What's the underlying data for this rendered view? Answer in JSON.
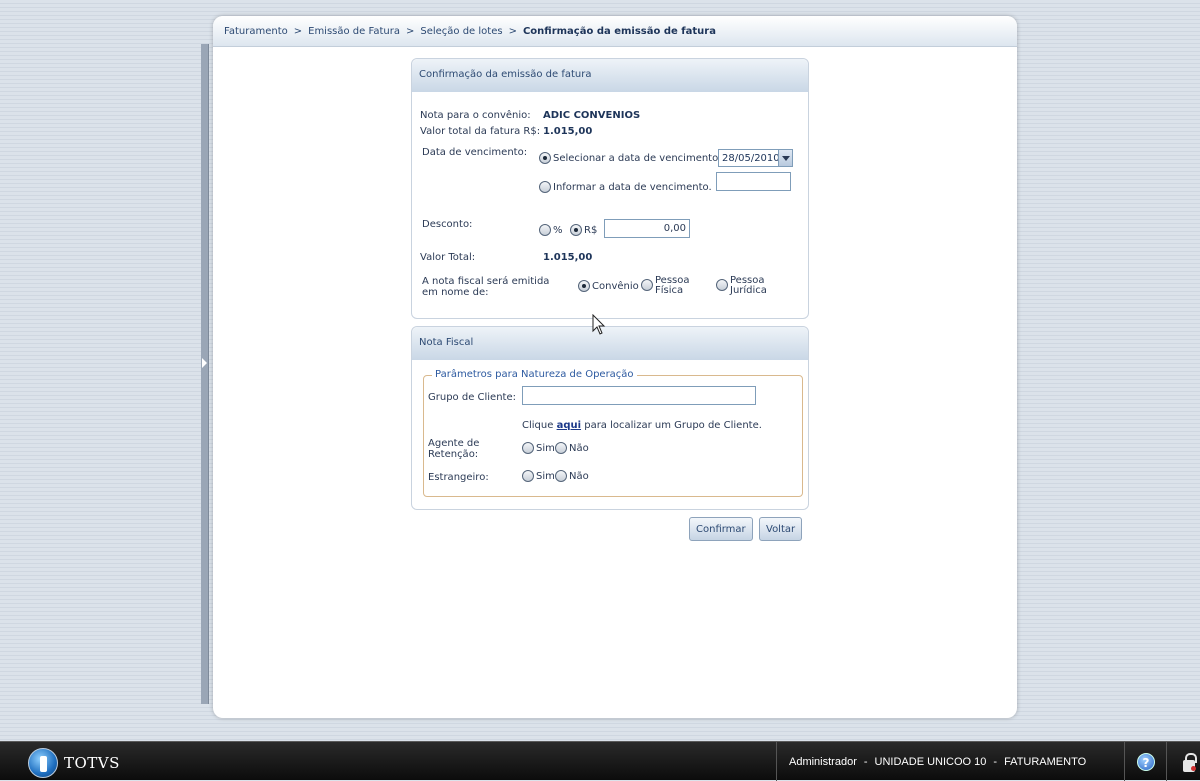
{
  "breadcrumb": {
    "items": [
      "Faturamento",
      "Emissão de Fatura",
      "Seleção de lotes"
    ],
    "current": "Confirmação da emissão de fatura",
    "separator": ">"
  },
  "confirm_panel": {
    "title": "Confirmação da emissão de fatura",
    "nota_label": "Nota para o convênio:",
    "nota_value": "ADIC CONVENIOS",
    "valor_label": "Valor total da fatura R$:",
    "valor_value": "1.015,00",
    "vencimento_label": "Data de vencimento:",
    "option_select_label": "Selecionar a data de vencimento.",
    "selected_date": "28/05/2010",
    "option_inform_label": "Informar a data de vencimento.",
    "inform_date_value": "",
    "desconto_label": "Desconto:",
    "desconto_percent_label": "%",
    "desconto_rs_label": "R$",
    "desconto_value": "0,00",
    "valor_total_label": "Valor Total:",
    "valor_total_value": "1.015,00",
    "emitida_label": "A nota fiscal será emitida em nome de:",
    "emitida_options": [
      "Convênio",
      "Pessoa Física",
      "Pessoa Jurídica"
    ]
  },
  "nota_panel": {
    "title": "Nota Fiscal",
    "legend": "Parâmetros para Natureza de Operação",
    "grupo_label": "Grupo de Cliente:",
    "grupo_value": "",
    "clique_before": "Clique",
    "clique_link": "aqui",
    "clique_after": "para localizar um Grupo de Cliente.",
    "agente_label": "Agente de Retenção:",
    "estrangeiro_label": "Estrangeiro:",
    "sim_label": "Sim",
    "nao_label": "Não"
  },
  "actions": {
    "confirm_label": "Confirmar",
    "back_label": "Voltar"
  },
  "taskbar": {
    "brand": "TOTVS",
    "user": "Administrador",
    "unit": "UNIDADE UNICOO 10",
    "module": "FATURAMENTO",
    "separator": "-",
    "help_glyph": "?"
  },
  "icons": {
    "help": "help-icon",
    "lock": "lock-icon",
    "logo": "totvs-logo-icon",
    "dropdown": "chevron-down-icon"
  }
}
